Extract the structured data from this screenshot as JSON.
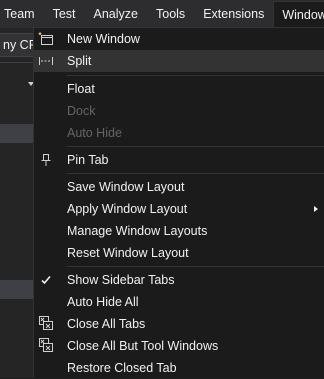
{
  "menubar": {
    "items": [
      "Team",
      "Test",
      "Analyze",
      "Tools",
      "Extensions",
      "Window"
    ]
  },
  "background": {
    "combo_text": "ny CP"
  },
  "window_menu": {
    "new_window": "New Window",
    "split": "Split",
    "float": "Float",
    "dock": "Dock",
    "auto_hide": "Auto Hide",
    "pin_tab": "Pin Tab",
    "save_window_layout": "Save Window Layout",
    "apply_window_layout": "Apply Window Layout",
    "manage_window_layouts": "Manage Window Layouts",
    "reset_window_layout": "Reset Window Layout",
    "show_sidebar_tabs": "Show Sidebar Tabs",
    "auto_hide_all": "Auto Hide All",
    "close_all_tabs": "Close All Tabs",
    "close_all_but_tool_windows": "Close All But Tool Windows",
    "restore_closed_tab": "Restore Closed Tab"
  },
  "icons": {
    "new_window": "new-window-icon",
    "split": "split-icon",
    "pin_tab": "pin-icon",
    "show_sidebar_tabs": "checkmark-icon",
    "close_all_tabs": "close-tabs-icon",
    "close_all_but_tool_windows": "close-tabs-icon",
    "apply_window_layout": "chevron-right-icon"
  }
}
